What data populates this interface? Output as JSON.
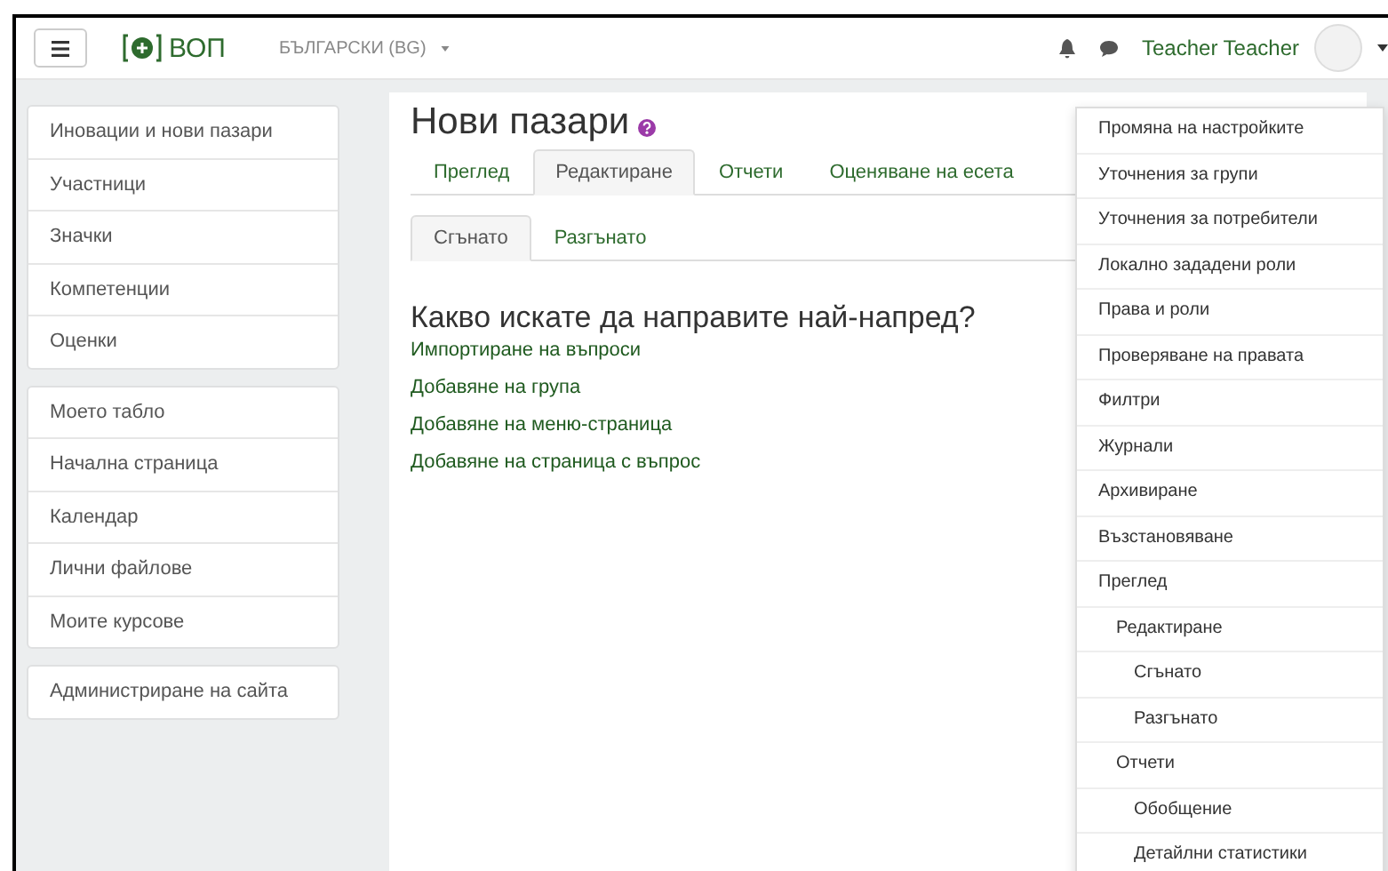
{
  "navbar": {
    "logo_text": "ВОП",
    "language": "БЪЛГАРСКИ (BG)",
    "user_name": "Teacher Teacher"
  },
  "sidebar": {
    "groups": [
      {
        "items": [
          "Иновации и нови пазари",
          "Участници",
          "Значки",
          "Компетенции",
          "Оценки"
        ]
      },
      {
        "items": [
          "Моето табло",
          "Начална страница",
          "Календар",
          "Лични файлове",
          "Моите курсове"
        ]
      },
      {
        "items": [
          "Администриране на сайта"
        ]
      }
    ]
  },
  "page": {
    "title": "Нови пазари",
    "tabs": [
      {
        "label": "Преглед",
        "selected": false
      },
      {
        "label": "Редактиране",
        "selected": true
      },
      {
        "label": "Отчети",
        "selected": false
      },
      {
        "label": "Оценяване на есета",
        "selected": false
      }
    ],
    "subtabs": [
      {
        "label": "Сгънато",
        "selected": true
      },
      {
        "label": "Разгънато",
        "selected": false
      }
    ],
    "heading": "Какво искате да направите най-напред?",
    "links": [
      "Импортиране на въпроси",
      "Добавяне на група",
      "Добавяне на меню-страница",
      "Добавяне на страница с въпрос"
    ]
  },
  "settings_menu": {
    "items": [
      {
        "label": "Промяна на настройките"
      },
      {
        "label": "Уточнения за групи"
      },
      {
        "label": "Уточнения за потребители"
      },
      {
        "label": "Локално зададени роли"
      },
      {
        "label": "Права и роли"
      },
      {
        "label": "Проверяване на правата"
      },
      {
        "label": "Филтри"
      },
      {
        "label": "Журнали"
      },
      {
        "label": "Архивиране"
      },
      {
        "label": "Възстановяване"
      },
      {
        "label": "Преглед",
        "children": [
          {
            "label": "Редактиране",
            "children": [
              {
                "label": "Сгънато"
              },
              {
                "label": "Разгънато"
              }
            ]
          },
          {
            "label": "Отчети",
            "children": [
              {
                "label": "Обобщение"
              },
              {
                "label": "Детайлни статистики"
              }
            ]
          }
        ]
      }
    ]
  }
}
